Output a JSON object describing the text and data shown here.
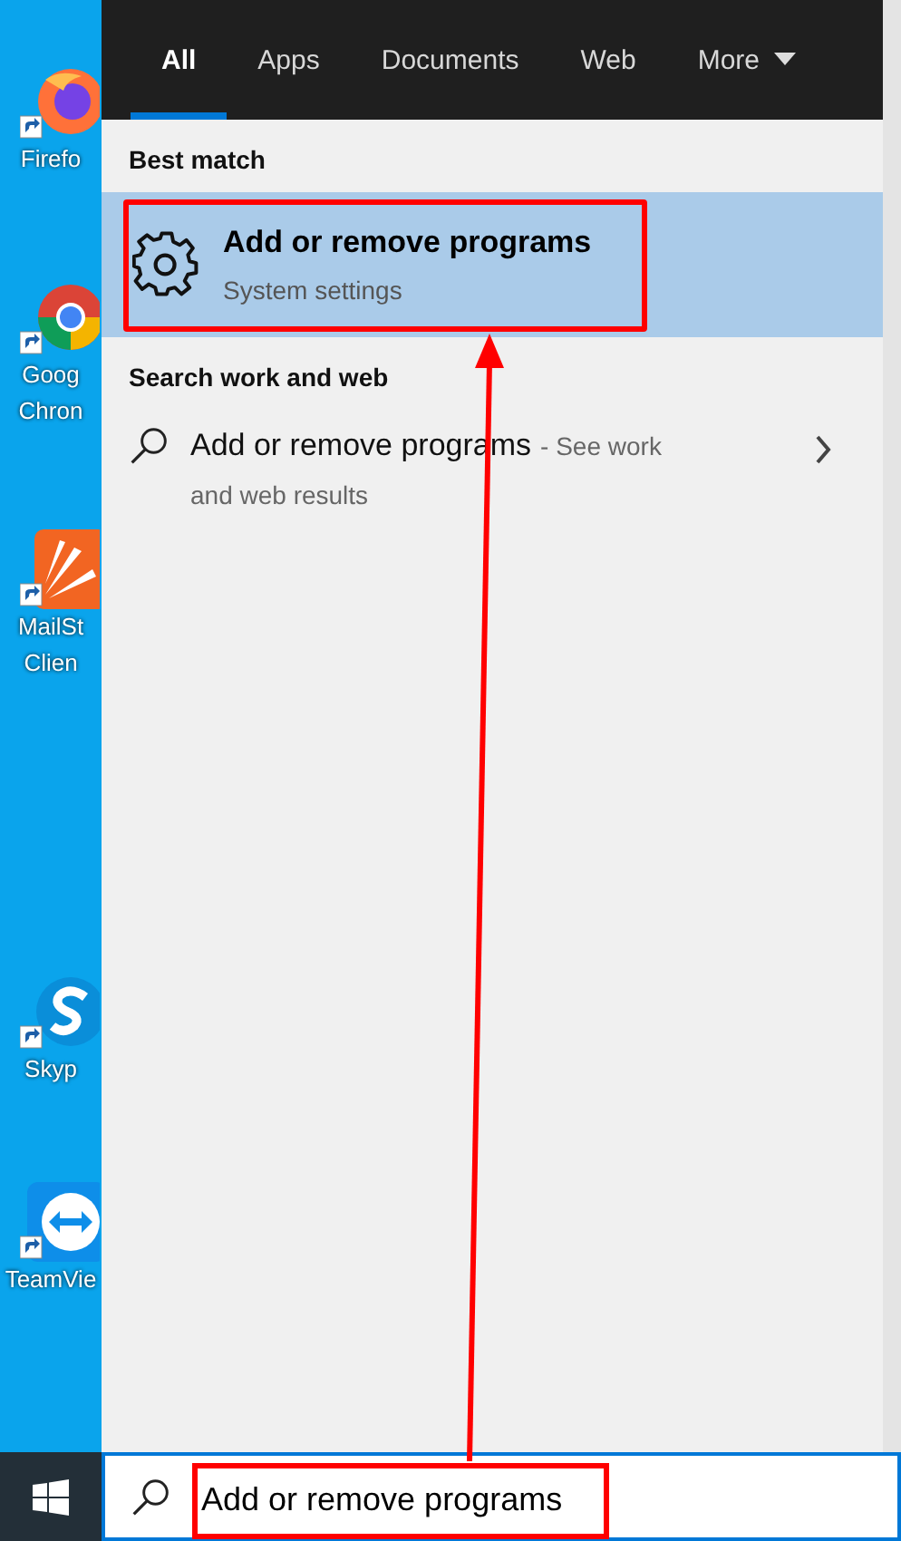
{
  "desktop_icons": [
    {
      "kind": "firefox",
      "lines": [
        "Firefo"
      ]
    },
    {
      "kind": "chrome",
      "lines": [
        "Goog",
        "Chron"
      ]
    },
    {
      "kind": "mailstore",
      "lines": [
        "MailSt",
        "Clien"
      ]
    },
    {
      "kind": "skype",
      "lines": [
        "Skyp"
      ]
    },
    {
      "kind": "teamviewer",
      "lines": [
        "TeamVie"
      ]
    }
  ],
  "tabs": [
    {
      "label": "All",
      "selected": true,
      "dropdown": false
    },
    {
      "label": "Apps",
      "selected": false,
      "dropdown": false
    },
    {
      "label": "Documents",
      "selected": false,
      "dropdown": false
    },
    {
      "label": "Web",
      "selected": false,
      "dropdown": false
    },
    {
      "label": "More",
      "selected": false,
      "dropdown": true
    }
  ],
  "best_match": {
    "heading": "Best match",
    "title": "Add or remove programs",
    "subtitle": "System settings",
    "selected": true
  },
  "web_search": {
    "heading": "Search work and web",
    "title": "Add or remove programs",
    "hint_lines": [
      "- See work",
      "and web results"
    ]
  },
  "search_box": {
    "value": "Add or remove programs"
  }
}
